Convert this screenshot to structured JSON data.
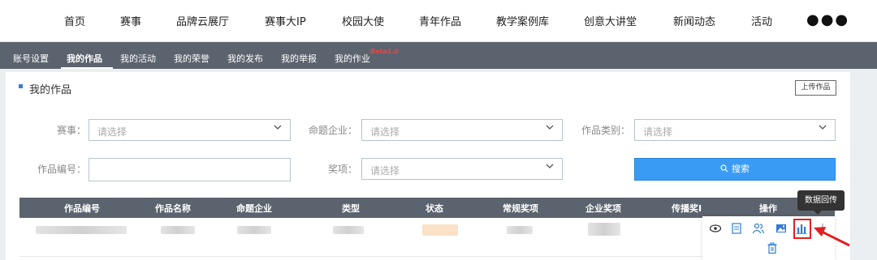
{
  "topnav": {
    "items": [
      "首页",
      "赛事",
      "品牌云展厅",
      "赛事大IP",
      "校园大使",
      "青年作品",
      "教学案例库",
      "创意大讲堂",
      "新闻动态",
      "活动"
    ],
    "more": "●●●"
  },
  "subnav": {
    "items": [
      "账号设置",
      "我的作品",
      "我的活动",
      "我的荣誉",
      "我的发布",
      "我的举报",
      "我的作业"
    ],
    "active": "我的作品",
    "beta": "Beta1.0"
  },
  "main": {
    "title": "我的作品",
    "upload_label": "上传作品",
    "filters": {
      "match_label": "赛事：",
      "company_label": "命题企业：",
      "category_label": "作品类别：",
      "id_label": "作品编号：",
      "award_label": "奖项：",
      "placeholder": "请选择"
    },
    "search_label": "搜索"
  },
  "table": {
    "headers": [
      "作品编号",
      "作品名称",
      "命题企业",
      "类型",
      "状态",
      "常规奖项",
      "企业奖项",
      "传播奖I",
      "操作"
    ],
    "tooltip": "数据回传"
  },
  "colors": {
    "header_bg": "#5b636e",
    "accent": "#3a9bf5",
    "highlight": "#e02020"
  }
}
